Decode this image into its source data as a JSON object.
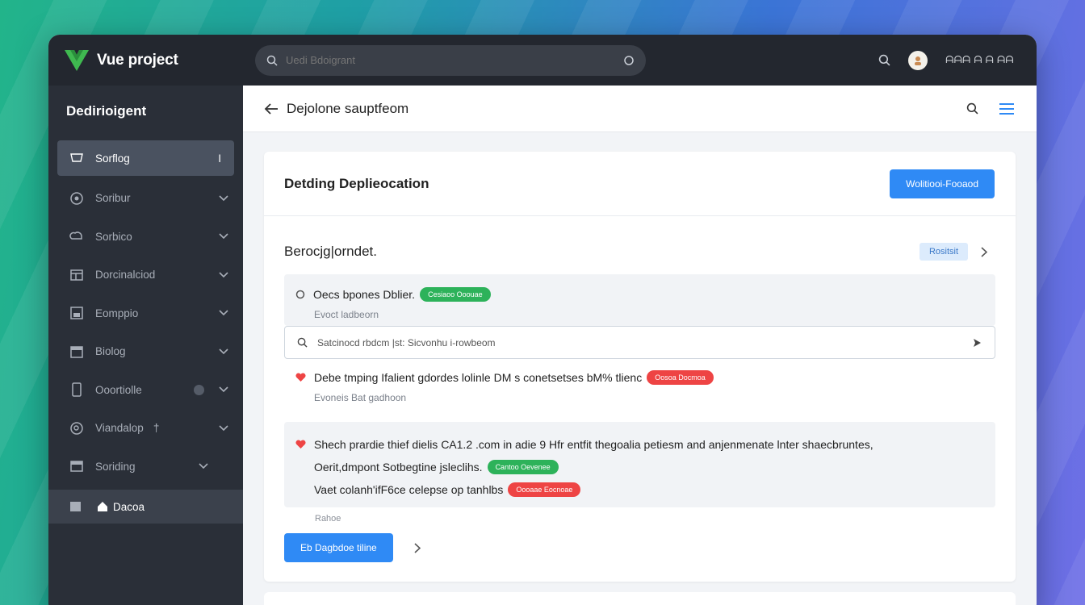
{
  "app": {
    "name": "Vue project"
  },
  "topbar": {
    "search_placeholder": "Uedi Bdoigrant",
    "user_text": "ᗩᗩᗩ ᗩ ᗩ ᗩᗩ"
  },
  "sidebar": {
    "title": "Dedirioigent",
    "items": [
      {
        "label": "Sorflog",
        "icon": "shield-icon",
        "active": true,
        "trailing": "I"
      },
      {
        "label": "Soribur",
        "icon": "gauge-icon"
      },
      {
        "label": "Sorbico",
        "icon": "cloud-icon"
      },
      {
        "label": "Dorcinalciod",
        "icon": "grid-icon"
      },
      {
        "label": "Eomppio",
        "icon": "box-icon"
      },
      {
        "label": "Biolog",
        "icon": "calendar-icon"
      },
      {
        "label": "Ooortiolle",
        "icon": "phone-icon"
      },
      {
        "label": "Viandalop",
        "icon": "search-circle-icon",
        "trailing": "†"
      },
      {
        "label": "Soriding",
        "icon": "table-icon"
      }
    ],
    "footer_label": "Dacoa"
  },
  "subheader": {
    "title": "Dejolone sauptfeom"
  },
  "card": {
    "heading": "Detding Deplieocation",
    "primary_button": "Wolitiooi-Fooaod",
    "section_title": "Berocjg|orndet.",
    "section_tag": "Rositsit",
    "block1": {
      "text": "Oecs bpones Dblier.",
      "pill": "Cesiaoo Ooouae",
      "sub": "Evoct ladbeorn"
    },
    "search": {
      "text": "Satcinocd rbdcm |st: Sicvonhu i-rowbeom"
    },
    "block3": {
      "text": "Debe tmping Ifalient gdordes lolinle DM s conetsetses bM% tlienc",
      "pill": "Oosoa Docmoa",
      "sub": "Evoneis Bat gadhoon"
    },
    "block4": {
      "line1": "Shech prardie thief dielis CA1.2 .com in adie 9 Hfr entfit thegoalia petiesm and anjenmenate lnter shaecbruntes,",
      "line2": "Oerit,dmpont Sotbegtine jsleclihs.",
      "line2_pill": "Cantoo Oevenee",
      "line3": "Vaet colanh'ifF6ce celepse op tanhlbs",
      "line3_pill": "Oooaae Eocnoae"
    },
    "footnote": "Rahoe",
    "action_button": "Eb Dagbdoe tiline"
  },
  "colors": {
    "accent": "#2f8af5",
    "green": "#2db25a",
    "red": "#ee4444",
    "sidebar": "#2a2f38",
    "topbar": "#23272f"
  }
}
